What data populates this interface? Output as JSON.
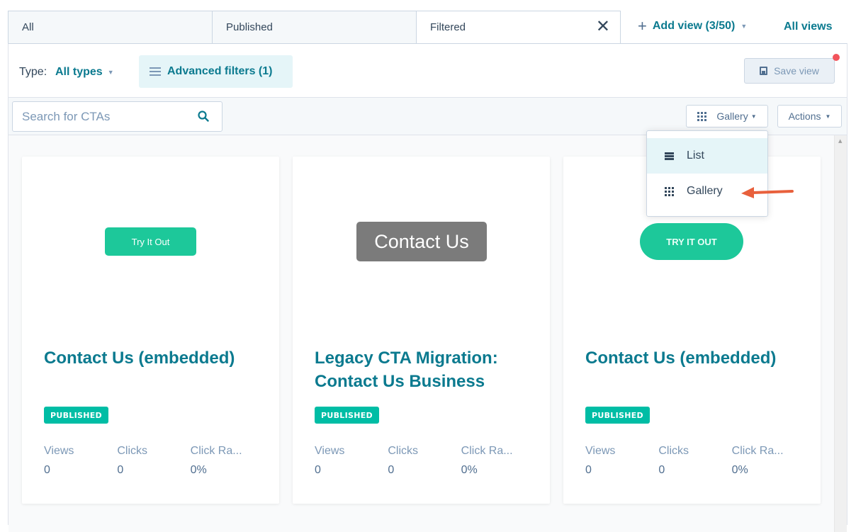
{
  "tabs": [
    {
      "label": "All",
      "active": false
    },
    {
      "label": "Published",
      "active": false
    },
    {
      "label": "Filtered",
      "active": true,
      "closable": true
    }
  ],
  "header_actions": {
    "add_view_label": "Add view (3/50)",
    "all_views_label": "All views"
  },
  "filters": {
    "type_label": "Type:",
    "type_value": "All types",
    "advanced_filters_label": "Advanced filters (1)",
    "save_view_label": "Save view",
    "save_view_has_notification": true
  },
  "toolbar": {
    "search_placeholder": "Search for CTAs",
    "search_value": "",
    "view_mode_label": "Gallery",
    "actions_label": "Actions"
  },
  "view_dropdown": {
    "items": [
      {
        "label": "List",
        "icon": "list-icon",
        "highlighted": true
      },
      {
        "label": "Gallery",
        "icon": "grid-icon",
        "highlighted": false
      }
    ]
  },
  "cards": [
    {
      "preview_button": "Try It Out",
      "title": "Contact Us (embedded)",
      "status": "PUBLISHED",
      "stats": [
        {
          "label": "Views",
          "value": "0"
        },
        {
          "label": "Clicks",
          "value": "0"
        },
        {
          "label": "Click Ra...",
          "value": "0%"
        }
      ]
    },
    {
      "preview_button": "Contact Us",
      "title": "Legacy CTA Migration: Contact Us Business",
      "status": "PUBLISHED",
      "stats": [
        {
          "label": "Views",
          "value": "0"
        },
        {
          "label": "Clicks",
          "value": "0"
        },
        {
          "label": "Click Ra...",
          "value": "0%"
        }
      ]
    },
    {
      "preview_button": "TRY IT OUT",
      "title": "Contact Us (embedded)",
      "status": "PUBLISHED",
      "stats": [
        {
          "label": "Views",
          "value": "0"
        },
        {
          "label": "Clicks",
          "value": "0"
        },
        {
          "label": "Click Ra...",
          "value": "0%"
        }
      ]
    }
  ],
  "colors": {
    "brand_teal": "#0b7a8f",
    "badge_green": "#00bda5",
    "cta_green": "#1dc89a",
    "cta_gray": "#7b7b7b",
    "notification_red": "#f2545b",
    "annotation_arrow": "#e8603c"
  }
}
